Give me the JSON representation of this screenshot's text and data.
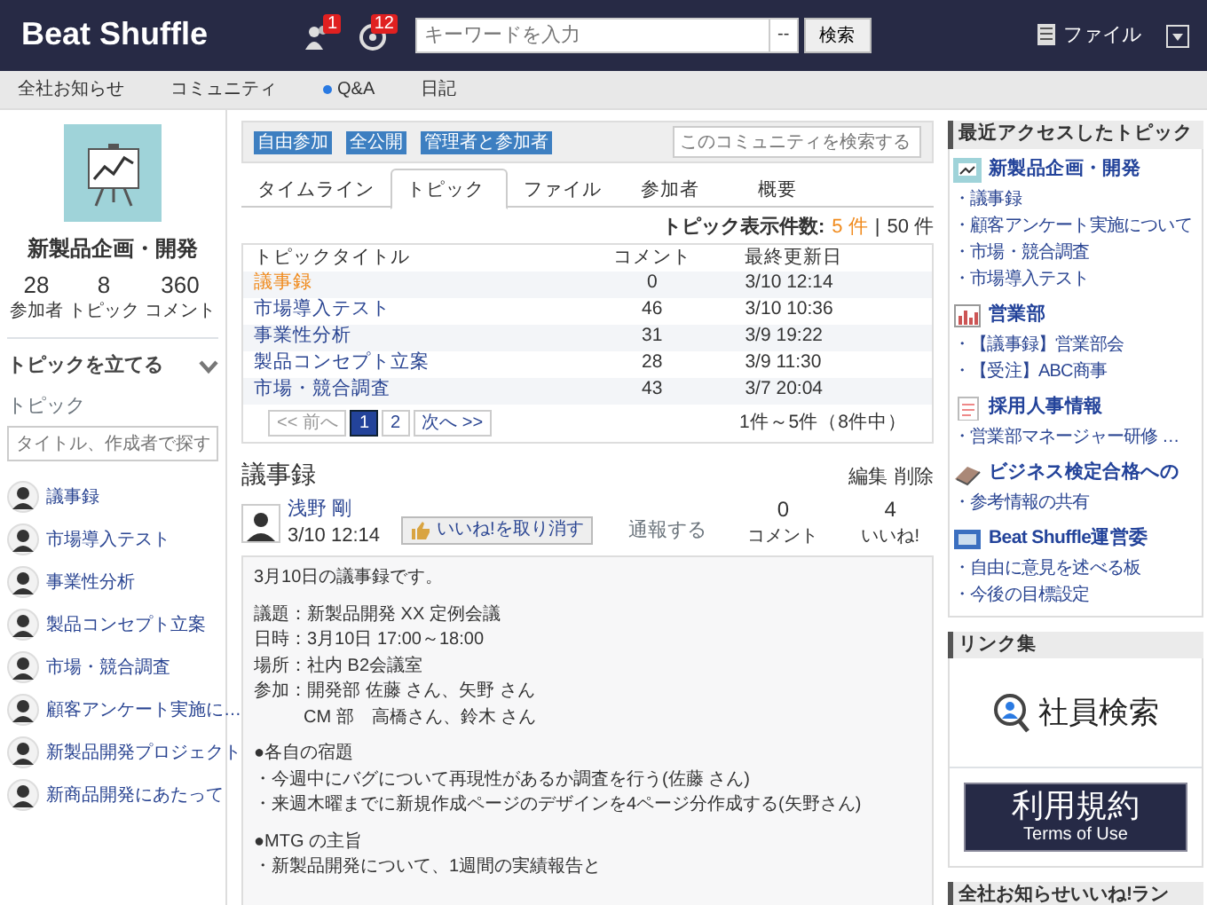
{
  "header": {
    "logo": "Beat Shuffle",
    "notifications": [
      {
        "count": "1"
      },
      {
        "count": "12"
      }
    ],
    "search": {
      "placeholder": "キーワードを入力",
      "select": "--",
      "button": "検索"
    },
    "file_link": "ファイル"
  },
  "nav": [
    {
      "label": "全社お知らせ",
      "unread": false
    },
    {
      "label": "コミュニティ",
      "unread": false
    },
    {
      "label": "Q&A",
      "unread": true
    },
    {
      "label": "日記",
      "unread": false
    }
  ],
  "community": {
    "name": "新製品企画・開発",
    "stats": [
      {
        "value": "28",
        "label": "参加者"
      },
      {
        "value": "8",
        "label": "トピック"
      },
      {
        "value": "360",
        "label": "コメント"
      }
    ],
    "create_topic": "トピックを立てる",
    "topics_heading": "トピック",
    "search_placeholder": "タイトル、作成者で探す",
    "topics": [
      {
        "title": "議事録"
      },
      {
        "title": "市場導入テスト"
      },
      {
        "title": "事業性分析"
      },
      {
        "title": "製品コンセプト立案"
      },
      {
        "title": "市場・競合調査"
      },
      {
        "title": "顧客アンケート実施に…"
      },
      {
        "title": "新製品開発プロジェクト"
      },
      {
        "title": "新商品開発にあたって"
      }
    ]
  },
  "tags": [
    "自由参加",
    "全公開",
    "管理者と参加者"
  ],
  "community_search": {
    "placeholder": "このコミュニティを検索する"
  },
  "tabs": [
    {
      "label": "タイムライン",
      "selected": false
    },
    {
      "label": "トピック",
      "selected": true
    },
    {
      "label": "ファイル",
      "selected": false
    },
    {
      "label": "参加者",
      "selected": false
    },
    {
      "label": "概要",
      "selected": false
    }
  ],
  "page_size": {
    "label": "トピック表示件数:",
    "separator": "|",
    "options": [
      {
        "label": "5 件",
        "selected": true
      },
      {
        "label": "50 件",
        "selected": false
      }
    ]
  },
  "table": {
    "columns": [
      "トピックタイトル",
      "コメント",
      "最終更新日"
    ],
    "rows": [
      {
        "title": "議事録",
        "comments": "0",
        "updated": "3/10 12:14",
        "selected": true
      },
      {
        "title": "市場導入テスト",
        "comments": "46",
        "updated": "3/10 10:36",
        "selected": false
      },
      {
        "title": "事業性分析",
        "comments": "31",
        "updated": "3/9 19:22",
        "selected": false
      },
      {
        "title": "製品コンセプト立案",
        "comments": "28",
        "updated": "3/9 11:30",
        "selected": false
      },
      {
        "title": "市場・競合調査",
        "comments": "43",
        "updated": "3/7 20:04",
        "selected": false
      }
    ]
  },
  "pagination": {
    "prev": "<< 前へ",
    "pages": [
      {
        "label": "1",
        "selected": true
      },
      {
        "label": "2",
        "selected": false
      }
    ],
    "next": "次へ >>",
    "range": "1件～5件（8件中）"
  },
  "post": {
    "title": "議事録",
    "actions": [
      "編集",
      "削除"
    ],
    "author": "浅野 剛",
    "date": "3/10 12:14",
    "like_button": "いいね!を取り消す",
    "report": "通報する",
    "stats": [
      {
        "value": "0",
        "label": "コメント"
      },
      {
        "value": "4",
        "label": "いいね!"
      }
    ],
    "body": [
      {
        "kind": "text",
        "text": "3月10日の議事録です。"
      },
      {
        "kind": "blank"
      },
      {
        "kind": "text",
        "text": "議題：新製品開発 XX 定例会議"
      },
      {
        "kind": "text",
        "text": "日時：3月10日 17:00～18:00"
      },
      {
        "kind": "text",
        "text": "場所：社内 B2会議室"
      },
      {
        "kind": "text",
        "text": "参加：開発部 佐藤 さん、矢野 さん"
      },
      {
        "kind": "indent",
        "text": "CM 部　高橋さん、鈴木 さん"
      },
      {
        "kind": "blank"
      },
      {
        "kind": "text",
        "text": "●各自の宿題"
      },
      {
        "kind": "text",
        "text": "・今週中にバグについて再現性があるか調査を行う(佐藤 さん)"
      },
      {
        "kind": "text",
        "text": "・来週木曜までに新規作成ページのデザインを4ページ分作成する(矢野さん)"
      },
      {
        "kind": "blank"
      },
      {
        "kind": "text",
        "text": "●MTG の主旨"
      },
      {
        "kind": "text",
        "text": "・新製品開発について、1週間の実績報告と"
      }
    ]
  },
  "recent": {
    "title": "最近アクセスしたトピック",
    "groups": [
      {
        "kind": "presentation",
        "name": "新製品企画・開発",
        "items": [
          "・議事録",
          "・顧客アンケート実施について",
          "・市場・競合調査",
          "・市場導入テスト"
        ]
      },
      {
        "kind": "chart",
        "name": "営業部",
        "items": [
          "・【議事録】営業部会",
          "・【受注】ABC商事"
        ]
      },
      {
        "kind": "document",
        "name": "採用人事情報",
        "items": [
          "・営業部マネージャー研修 …"
        ]
      },
      {
        "kind": "book",
        "name": "ビジネス検定合格への",
        "items": [
          "・参考情報の共有"
        ]
      },
      {
        "kind": "monitor",
        "name": "Beat Shuffle運営委",
        "items": [
          "・自由に意見を述べる板",
          "・今後の目標設定"
        ]
      }
    ]
  },
  "links": {
    "title": "リンク集",
    "employee_search": "社員検索",
    "terms": "利用規約",
    "terms_en": "Terms of Use"
  },
  "ranking": {
    "title": "全社お知らせいいね!ラン"
  }
}
